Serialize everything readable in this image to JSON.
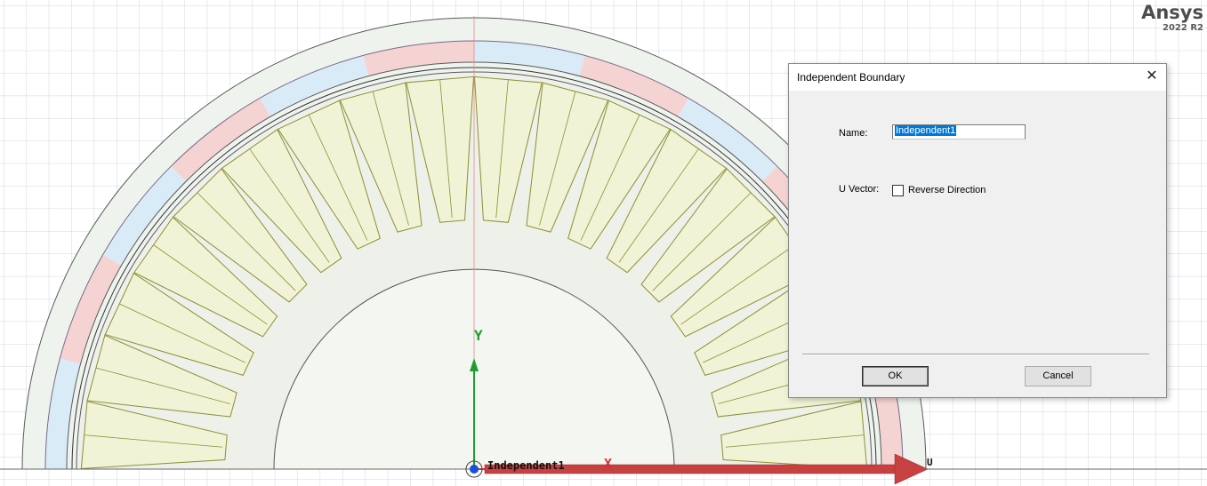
{
  "brand": {
    "name": "Ansys",
    "version": "2022 R2"
  },
  "viewport": {
    "axis_y_label": "Y",
    "axis_x_label": "X",
    "u_vector_label": "U",
    "boundary_label": "Independent1",
    "colors": {
      "grid": "#c9d2de",
      "red_band": "#f6d3d3",
      "blue_band": "#d9ebf6",
      "slot_fill": "#f1f3d6",
      "slot_stroke": "#8d8f32",
      "u_arrow": "#c84141",
      "y_axis": "#1e9e32",
      "x_axis": "#d23232"
    },
    "slot_count": 18
  },
  "dialog": {
    "title": "Independent Boundary",
    "close_glyph": "✕",
    "name_label": "Name:",
    "name_value": "Independent1",
    "u_vector_label": "U Vector:",
    "reverse_direction_label": "Reverse Direction",
    "reverse_direction_checked": false,
    "ok_label": "OK",
    "cancel_label": "Cancel"
  }
}
